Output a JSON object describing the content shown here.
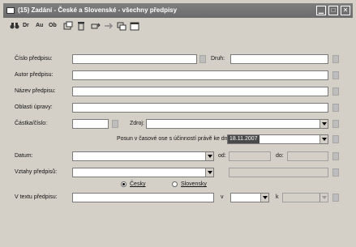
{
  "window": {
    "title": "(15) Zadání - České a Slovenské - všechny předpisy"
  },
  "toolbar": {
    "items": [
      {
        "name": "binoculars-icon"
      },
      {
        "label": "Dr"
      },
      {
        "label": "Au"
      },
      {
        "label": "Ob"
      },
      {
        "name": "new-window-icon"
      },
      {
        "name": "trash-icon"
      },
      {
        "name": "undo-icon"
      },
      {
        "name": "redo-icon"
      },
      {
        "name": "copy-window-icon"
      },
      {
        "name": "calendar-icon"
      }
    ]
  },
  "form": {
    "cislo_label": "Číslo předpisu:",
    "druh_label": "Druh:",
    "autor_label": "Autor předpisu:",
    "nazev_label": "Název předpisu:",
    "oblasti_label": "Oblasti úpravy:",
    "castka_label": "Částka/číslo:",
    "zdroj_label": "Zdroj:",
    "posun_label": "Posun v časové ose s účinností právě ke dni:",
    "date_value": "18.11.2007",
    "datum_label": "Datum:",
    "od_label": "od:",
    "do_label": "do:",
    "vztahy_label": "Vztahy předpisů:",
    "radio_cesky": "Česky",
    "radio_slovensky": "Slovensky",
    "text_label": "V textu předpisu:",
    "v_label": "v",
    "k_label": "k"
  }
}
